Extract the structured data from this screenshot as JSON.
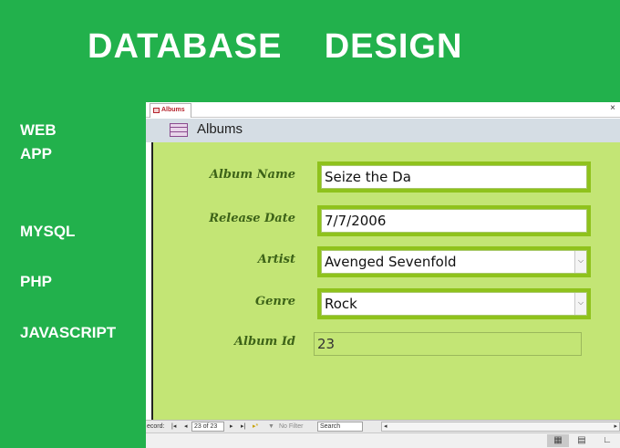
{
  "banner": {
    "title": "DATABASE    DESIGN"
  },
  "sidebar": {
    "items": [
      {
        "label": "WEB\nAPP"
      },
      {
        "label": "MYSQL"
      },
      {
        "label": "PHP"
      },
      {
        "label": "JAVASCRIPT"
      }
    ]
  },
  "window": {
    "tab_label": "Albums",
    "close_glyph": "×",
    "form_title": "Albums"
  },
  "form": {
    "fields": [
      {
        "label": "Album Name",
        "value": "Seize the Da",
        "type": "text"
      },
      {
        "label": "Release Date",
        "value": "7/7/2006",
        "type": "text"
      },
      {
        "label": "Artist",
        "value": "Avenged Sevenfold",
        "type": "combo"
      },
      {
        "label": "Genre",
        "value": "Rock",
        "type": "combo"
      },
      {
        "label": "Album Id",
        "value": "23",
        "type": "readonly"
      }
    ]
  },
  "navigation": {
    "record_label": "ecord:",
    "first": "|◂",
    "prev": "◂",
    "current": "23 of 23",
    "next": "▸",
    "last": "▸|",
    "new": "▸*",
    "filter_label": "No Filter",
    "search_placeholder": "Search",
    "scroll_left": "◂",
    "scroll_right": "▸"
  },
  "statusbar": {
    "views": [
      "form-view-icon",
      "datasheet-view-icon",
      "layout-view-icon"
    ]
  },
  "colors": {
    "background": "#22b14c",
    "form_detail": "#c3e575",
    "field_border": "#8fc21c",
    "label": "#3d6318",
    "tab_accent": "#b5232c"
  }
}
